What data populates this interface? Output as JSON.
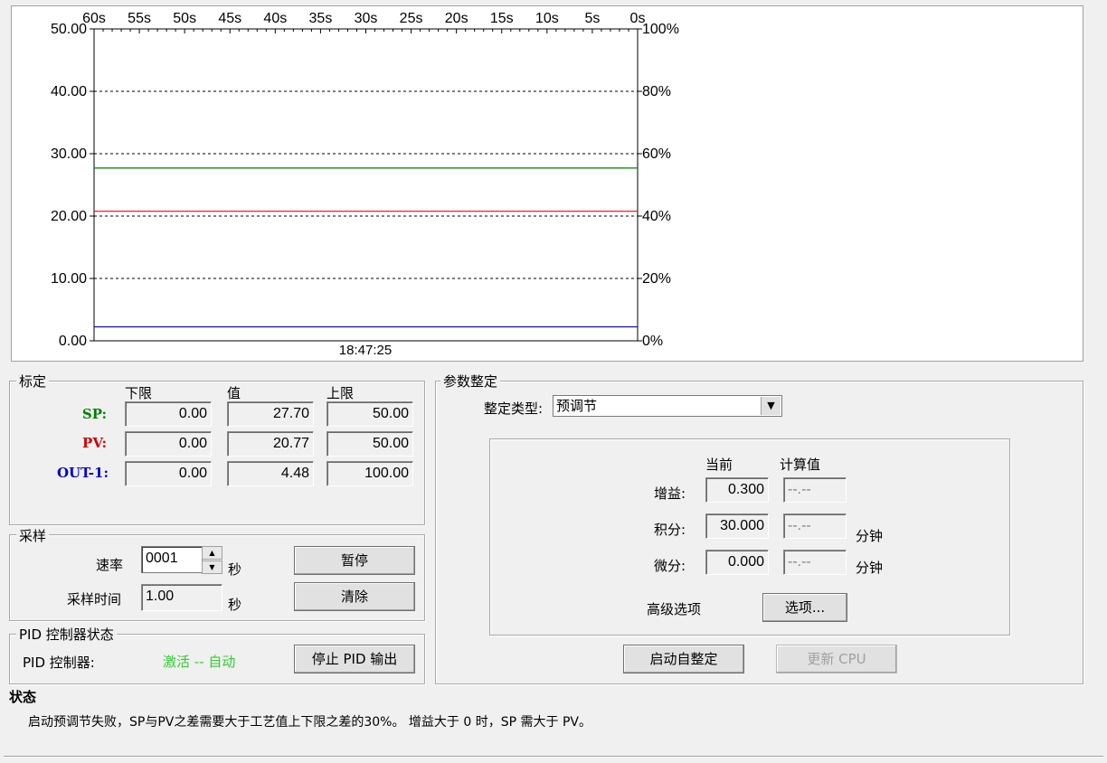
{
  "chart_data": {
    "type": "line",
    "x_ticks": [
      "60s",
      "55s",
      "50s",
      "45s",
      "40s",
      "35s",
      "30s",
      "25s",
      "20s",
      "15s",
      "10s",
      "5s",
      "0s"
    ],
    "y_left_ticks": [
      "50.00",
      "40.00",
      "30.00",
      "20.00",
      "10.00",
      "0.00"
    ],
    "y_right_ticks": [
      "100%",
      "80%",
      "60%",
      "40%",
      "20%",
      "0%"
    ],
    "ylim_left": [
      0,
      50
    ],
    "ylim_right": [
      0,
      100
    ],
    "time_label": "18:47:25",
    "grid": "dashed-horizontal",
    "series": [
      {
        "color": "#008000",
        "axis": "left",
        "values": [
          27.7,
          27.7
        ]
      },
      {
        "color": "#ff0000",
        "axis": "left",
        "values": [
          20.77,
          20.77
        ]
      },
      {
        "color": "#0000c0",
        "axis": "right",
        "values": [
          4.48,
          4.48
        ]
      }
    ]
  },
  "calibration": {
    "title": "标定",
    "col_low": "下限",
    "col_value": "值",
    "col_high": "上限",
    "rows": [
      {
        "label": "SP:",
        "color": "#008000",
        "low": "0.00",
        "value": "27.70",
        "high": "50.00"
      },
      {
        "label": "PV:",
        "color": "#d00000",
        "low": "0.00",
        "value": "20.77",
        "high": "50.00"
      },
      {
        "label": "OUT-1:",
        "color": "#0000d0",
        "low": "0.00",
        "value": "4.48",
        "high": "100.00"
      }
    ]
  },
  "sampling": {
    "title": "采样",
    "rate_label": "速率",
    "rate_value": "0001",
    "rate_unit": "秒",
    "time_label": "采样时间",
    "time_value": "1.00",
    "time_unit": "秒",
    "pause_button": "暂停",
    "clear_button": "清除"
  },
  "pid_status": {
    "title": "PID 控制器状态",
    "controller_label": "PID 控制器:",
    "state_text": "激活 -- 自动",
    "state_color": "#33cc33",
    "stop_button": "停止 PID 输出"
  },
  "tuning": {
    "title": "参数整定",
    "type_label": "整定类型:",
    "type_value": "预调节",
    "col_current": "当前",
    "col_calculated": "计算值",
    "gain_label": "增益:",
    "gain_current": "0.300",
    "gain_calc": "--.--",
    "integral_label": "积分:",
    "integral_current": "30.000",
    "integral_calc": "--.--",
    "integral_unit": "分钟",
    "derivative_label": "微分:",
    "derivative_current": "0.000",
    "derivative_calc": "--.--",
    "derivative_unit": "分钟",
    "advanced_label": "高级选项",
    "options_button": "选项...",
    "start_button": "启动自整定",
    "update_button": "更新 CPU"
  },
  "status": {
    "title": "状态",
    "message": "启动预调节失败，SP与PV之差需要大于工艺值上下限之差的30%。 增益大于 0 时，SP 需大于 PV。"
  }
}
